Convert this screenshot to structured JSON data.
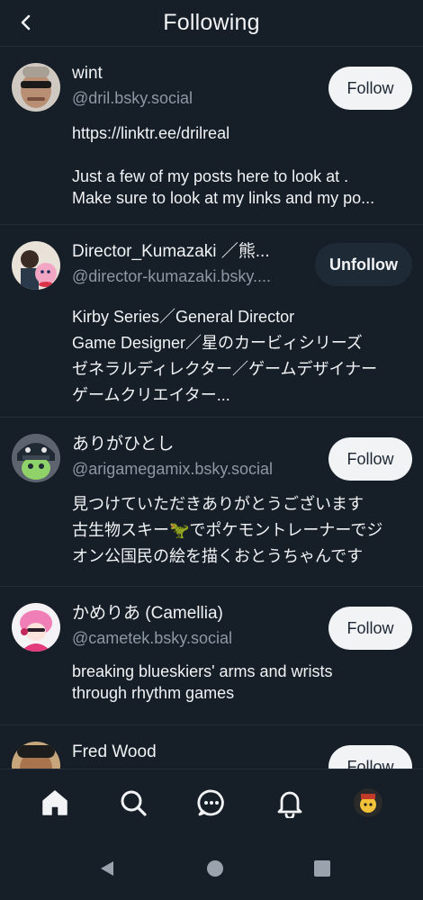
{
  "header": {
    "title": "Following"
  },
  "users": [
    {
      "name": "wint",
      "handle": "@dril.bsky.social",
      "bio": "https://linktr.ee/drilreal\n\nJust a few of my posts here to look at .\nMake sure to look at my links and my po...",
      "button": "Follow"
    },
    {
      "name": "Director_Kumazaki ／熊...",
      "handle": "@director-kumazaki.bsky....",
      "bio": "Kirby Series／General Director\nGame Designer／星のカービィシリーズ\nゼネラルディレクター／ゲームデザイナー\nゲームクリエイター...",
      "button": "Unfollow"
    },
    {
      "name": "ありがひとし",
      "handle": "@arigamegamix.bsky.social",
      "bio": "見つけていただきありがとうございます\n古生物スキー🦖でポケモントレーナーでジ\nオン公国民の絵を描くおとうちゃんです",
      "button": "Follow"
    },
    {
      "name": "かめりあ (Camellia)",
      "handle": "@cametek.bsky.social",
      "bio": "breaking blueskiers' arms and wrists\nthrough rhythm games",
      "button": "Follow"
    },
    {
      "name": "Fred Wood",
      "handle": "",
      "bio": "",
      "button": "Follow"
    }
  ],
  "nav": {
    "items": [
      "home-icon",
      "search-icon",
      "chat-icon",
      "bell-icon",
      "profile-avatar"
    ]
  },
  "colors": {
    "background": "#161e27",
    "divider": "#232d38",
    "follow_button_bg": "#f1f3f5",
    "unfollow_button_bg": "#1e2a36",
    "handle_text": "#8d98a5"
  }
}
